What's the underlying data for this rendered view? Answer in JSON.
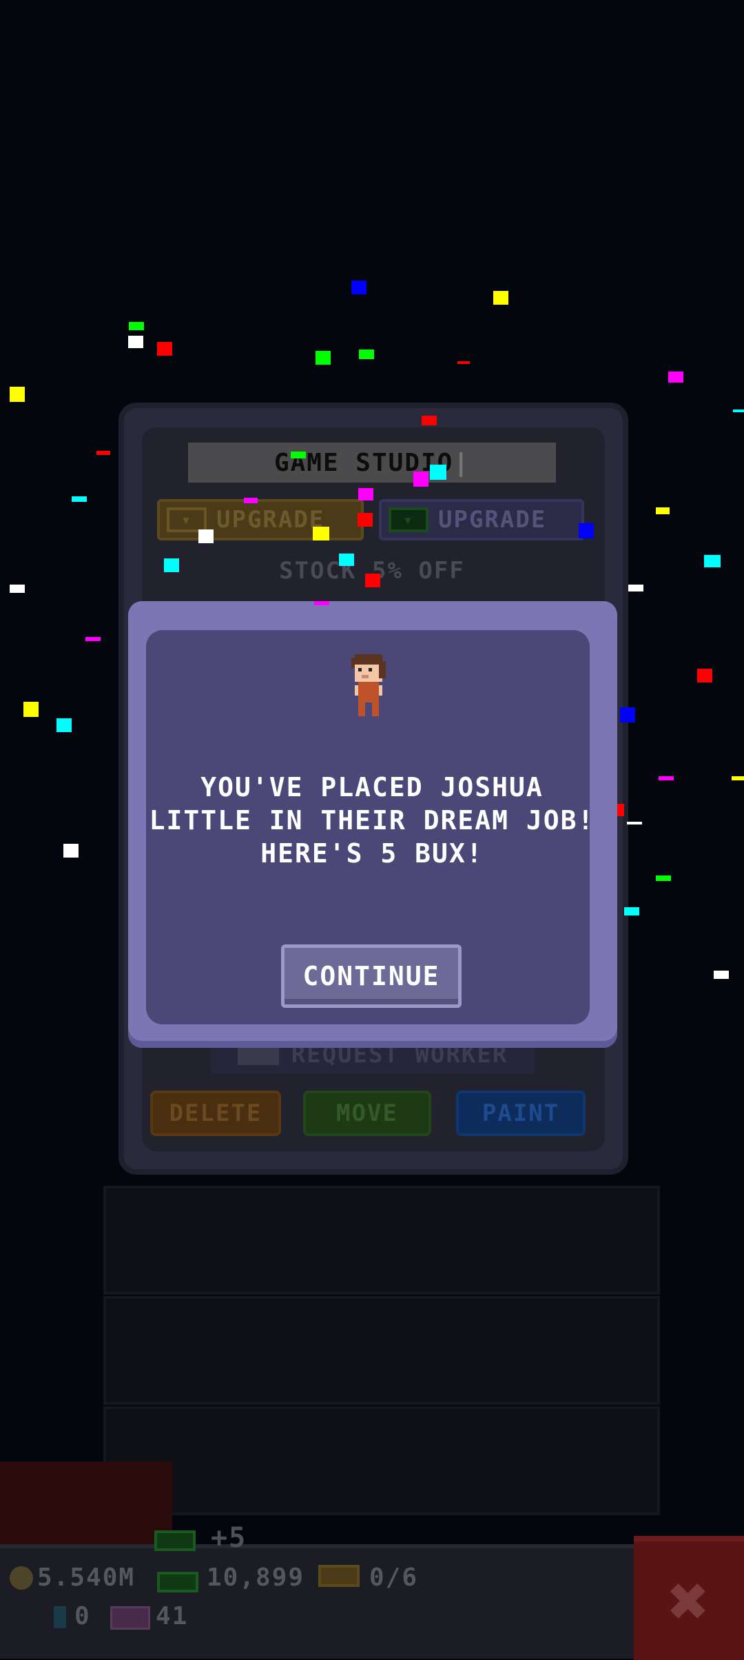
{
  "tower": {
    "floor_name": "GAME STUDIO",
    "upgrade_coin_label": "UPGRADE",
    "upgrade_bux_label": "UPGRADE",
    "stock_discount": "STOCK 5% OFF",
    "request_worker_label": "REQUEST WORKER",
    "delete_label": "DELETE",
    "move_label": "MOVE",
    "paint_label": "PAINT"
  },
  "dialog": {
    "message_line1": "YOU'VE PLACED JOSHUA",
    "message_line2": "LITTLE IN THEIR DREAM JOB!",
    "message_line3": "HERE'S 5 BUX!",
    "continue_label": "CONTINUE"
  },
  "stats": {
    "coins": "5.540M",
    "bux": "10,899",
    "tickets": "0/6",
    "gems": "0",
    "vip": "41",
    "bux_gain": "+5"
  },
  "colors": {
    "dialog_bg": "#4b4878",
    "dialog_border": "#7c77b4",
    "confetti": [
      "#ffff00",
      "#ff0000",
      "#00ff00",
      "#00ffff",
      "#0000ff",
      "#ff00ff",
      "#ffffff"
    ]
  },
  "icons": {
    "close": "close-icon",
    "coin": "coin-icon",
    "bux": "bux-icon",
    "ticket": "ticket-icon",
    "gem": "gem-icon",
    "vip": "vip-icon"
  }
}
